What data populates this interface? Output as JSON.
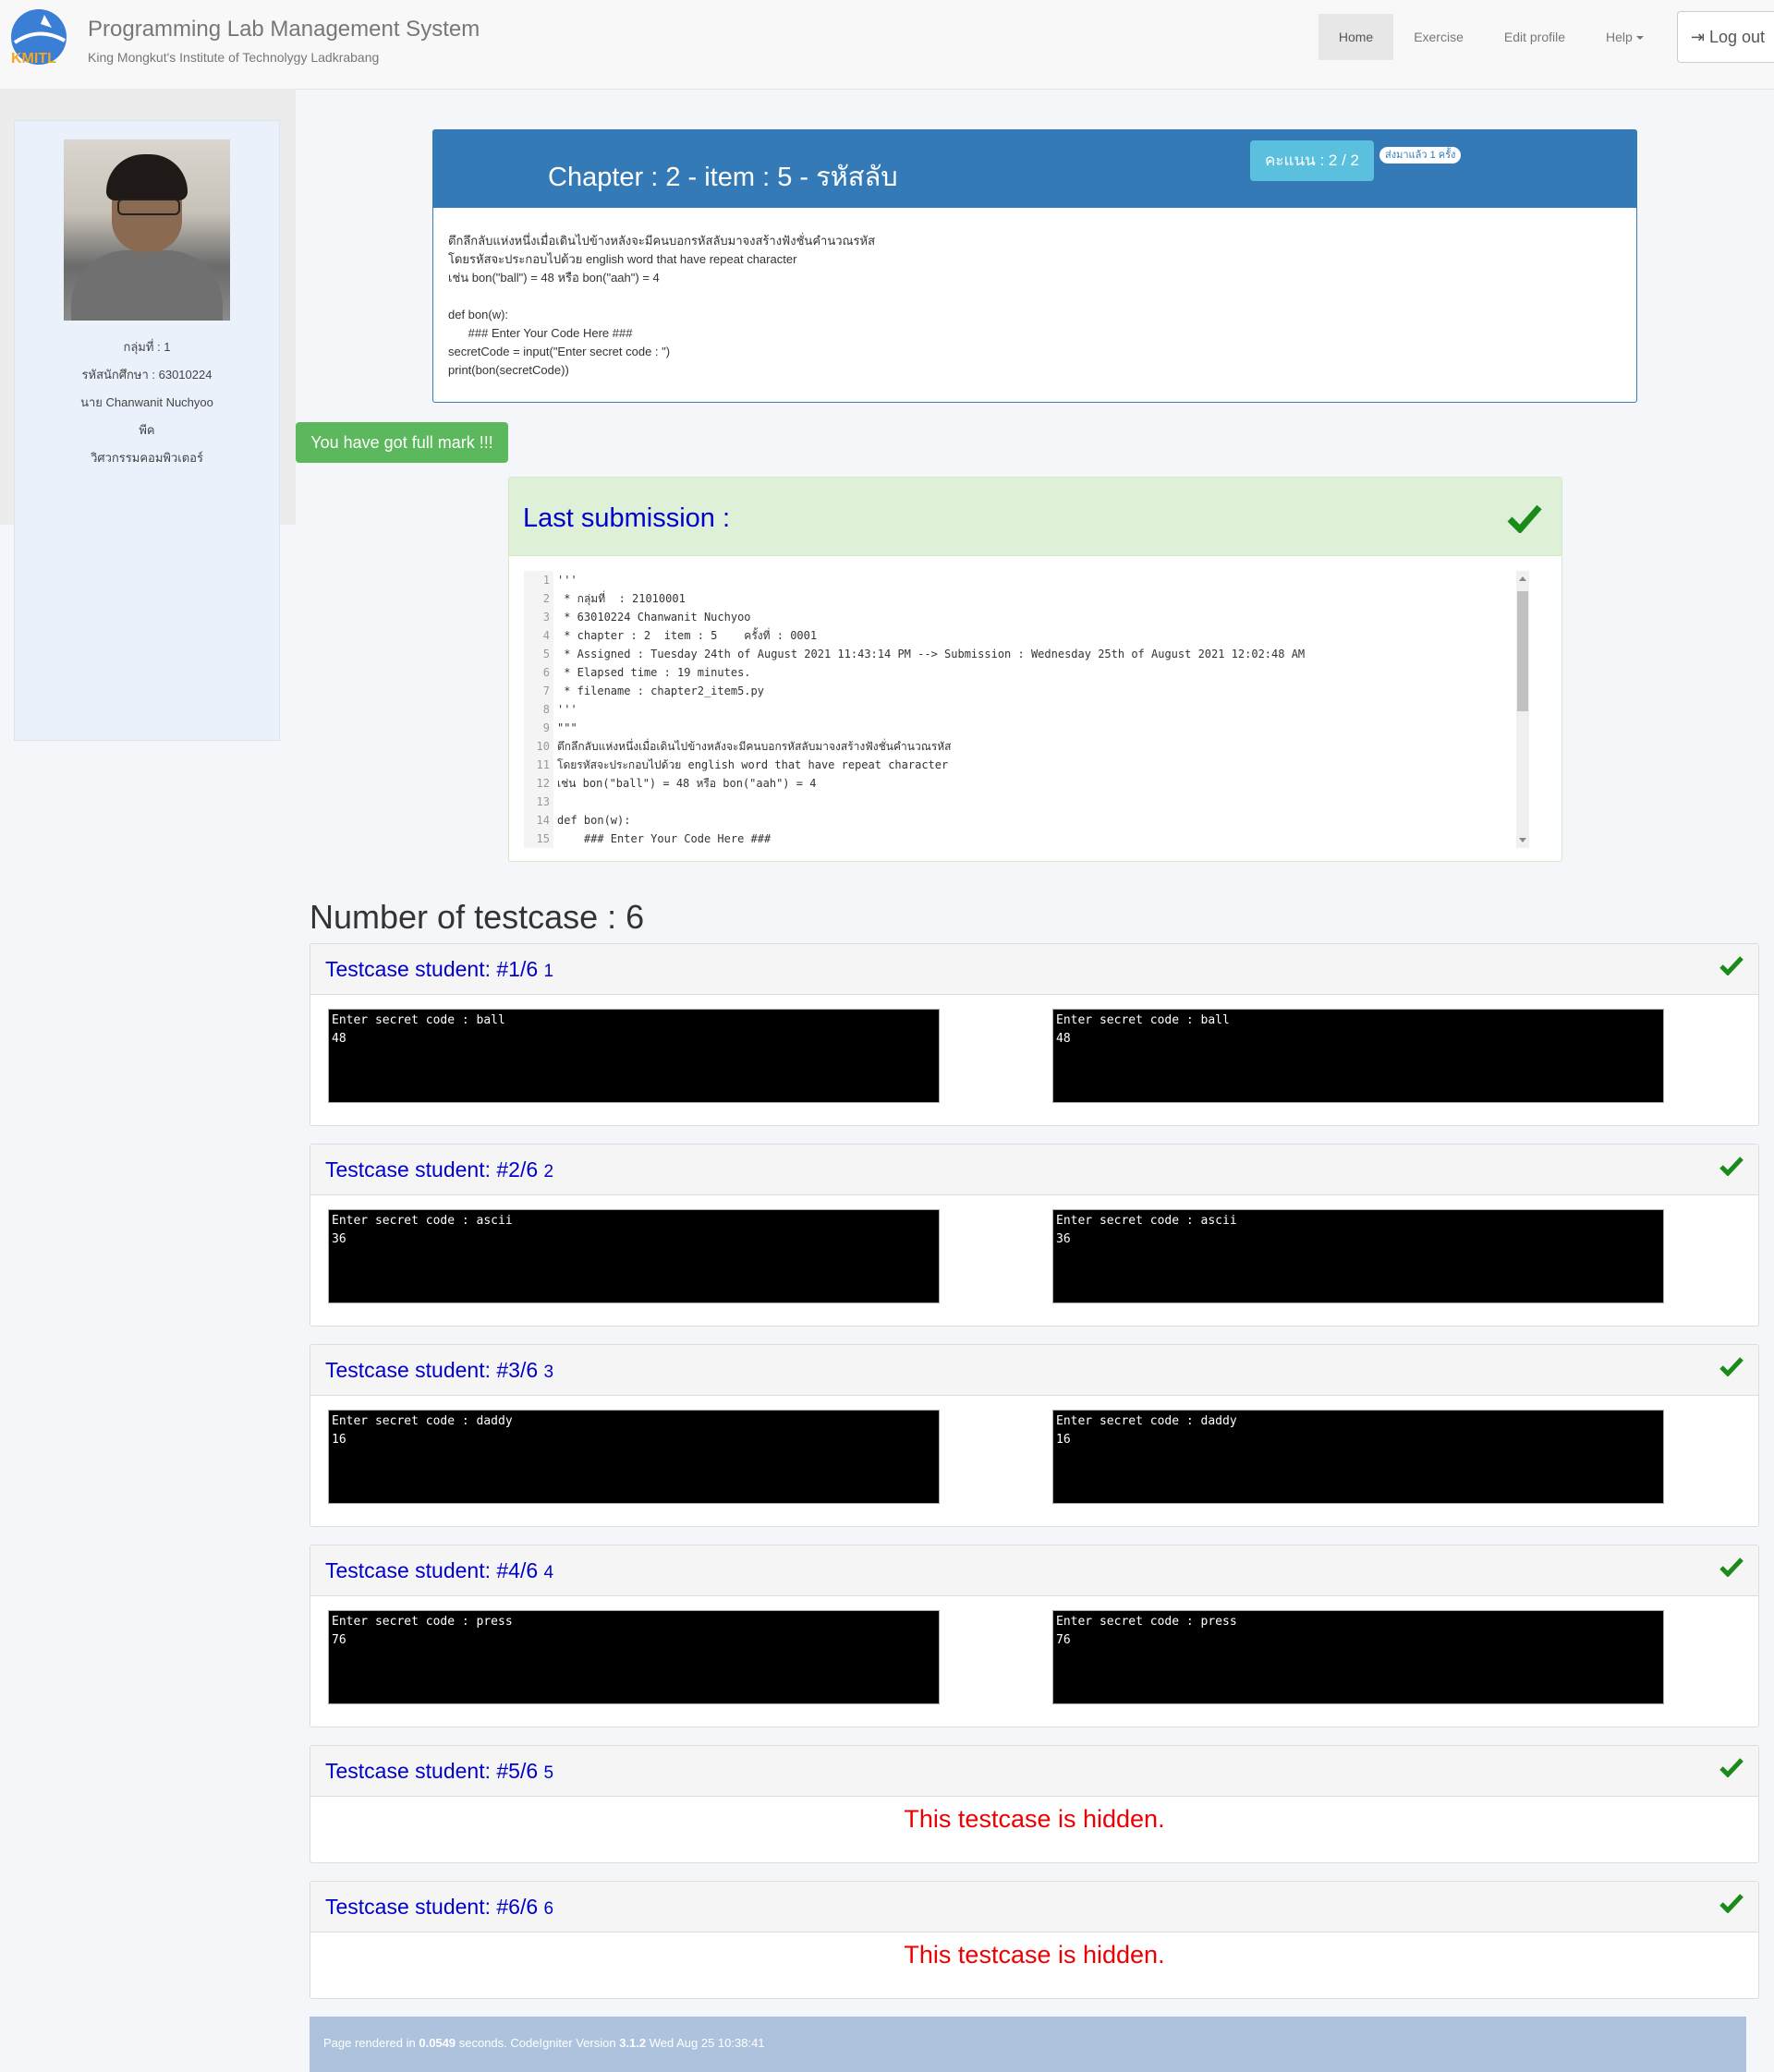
{
  "header": {
    "logo_text": "KMITL",
    "title": "Programming Lab Management System",
    "subtitle": "King Mongkut's Institute of Technolygy Ladkrabang",
    "nav": [
      "Home",
      "Exercise",
      "Edit profile",
      "Help"
    ],
    "logout": "Log out"
  },
  "sidebar": {
    "group": "กลุ่มที่ : 1",
    "student_id": "รหัสนักศึกษา : 63010224",
    "name": "นาย Chanwanit Nuchyoo",
    "nickname": "พีค",
    "department": "วิศวกรรมคอมพิวเตอร์"
  },
  "chapter": {
    "title": "Chapter : 2 - item : 5 - รหัสลับ",
    "score": "คะแนน : 2 / 2",
    "sent": "ส่งมาแล้ว 1 ครั้ง",
    "problem": "ตึกลึกลับแห่งหนึ่งเมื่อเดินไปข้างหลังจะมีคนบอกรหัสลับมาจงสร้างฟังชั่นคำนวณรหัส\nโดยรหัสจะประกอบไปด้วย english word that have repeat character\nเช่น bon(\"ball\") = 48 หรือ bon(\"aah\") = 4\n\ndef bon(w):\n      ### Enter Your Code Here ###\nsecretCode = input(\"Enter secret code : \")\nprint(bon(secretCode))"
  },
  "full_mark": "You have got full mark !!!",
  "last_submission": {
    "title": "Last submission :",
    "code_lines": [
      "'''",
      " * กลุ่มที่  : 21010001",
      " * 63010224 Chanwanit Nuchyoo",
      " * chapter : 2  item : 5    ครั้งที่ : 0001",
      " * Assigned : Tuesday 24th of August 2021 11:43:14 PM --> Submission : Wednesday 25th of August 2021 12:02:48 AM",
      " * Elapsed time : 19 minutes.",
      " * filename : chapter2_item5.py",
      "'''",
      "\"\"\"",
      "ตึกลึกลับแห่งหนึ่งเมื่อเดินไปข้างหลังจะมีคนบอกรหัสลับมาจงสร้างฟังชั่นคำนวณรหัส",
      "โดยรหัสจะประกอบไปด้วย english word that have repeat character",
      "เช่น bon(\"ball\") = 48 หรือ bon(\"aah\") = 4",
      "",
      "def bon(w):",
      "    ### Enter Your Code Here ###"
    ]
  },
  "testcase_count": "Number of testcase : 6",
  "testcases": [
    {
      "title": "Testcase student: #1/6",
      "num": "1",
      "expected": "Enter secret code : ball\n48",
      "actual": "Enter secret code : ball\n48"
    },
    {
      "title": "Testcase student: #2/6",
      "num": "2",
      "expected": "Enter secret code : ascii\n36",
      "actual": "Enter secret code : ascii\n36"
    },
    {
      "title": "Testcase student: #3/6",
      "num": "3",
      "expected": "Enter secret code : daddy\n16",
      "actual": "Enter secret code : daddy\n16"
    },
    {
      "title": "Testcase student: #4/6",
      "num": "4",
      "expected": "Enter secret code : press\n76",
      "actual": "Enter secret code : press\n76"
    },
    {
      "title": "Testcase student: #5/6",
      "num": "5",
      "hidden": "This testcase is hidden."
    },
    {
      "title": "Testcase student: #6/6",
      "num": "6",
      "hidden": "This testcase is hidden."
    }
  ],
  "footer": {
    "prefix": "Page rendered in ",
    "time": "0.0549",
    "middle": " seconds. CodeIgniter Version ",
    "version": "3.1.2",
    "date": " Wed Aug 25 10:38:41"
  },
  "colors": {
    "primary": "#337ab7",
    "success": "#5cb85c",
    "info": "#5bc0de",
    "link": "#0000cc",
    "check": "#1a8a1a",
    "hidden": "#e00000"
  }
}
